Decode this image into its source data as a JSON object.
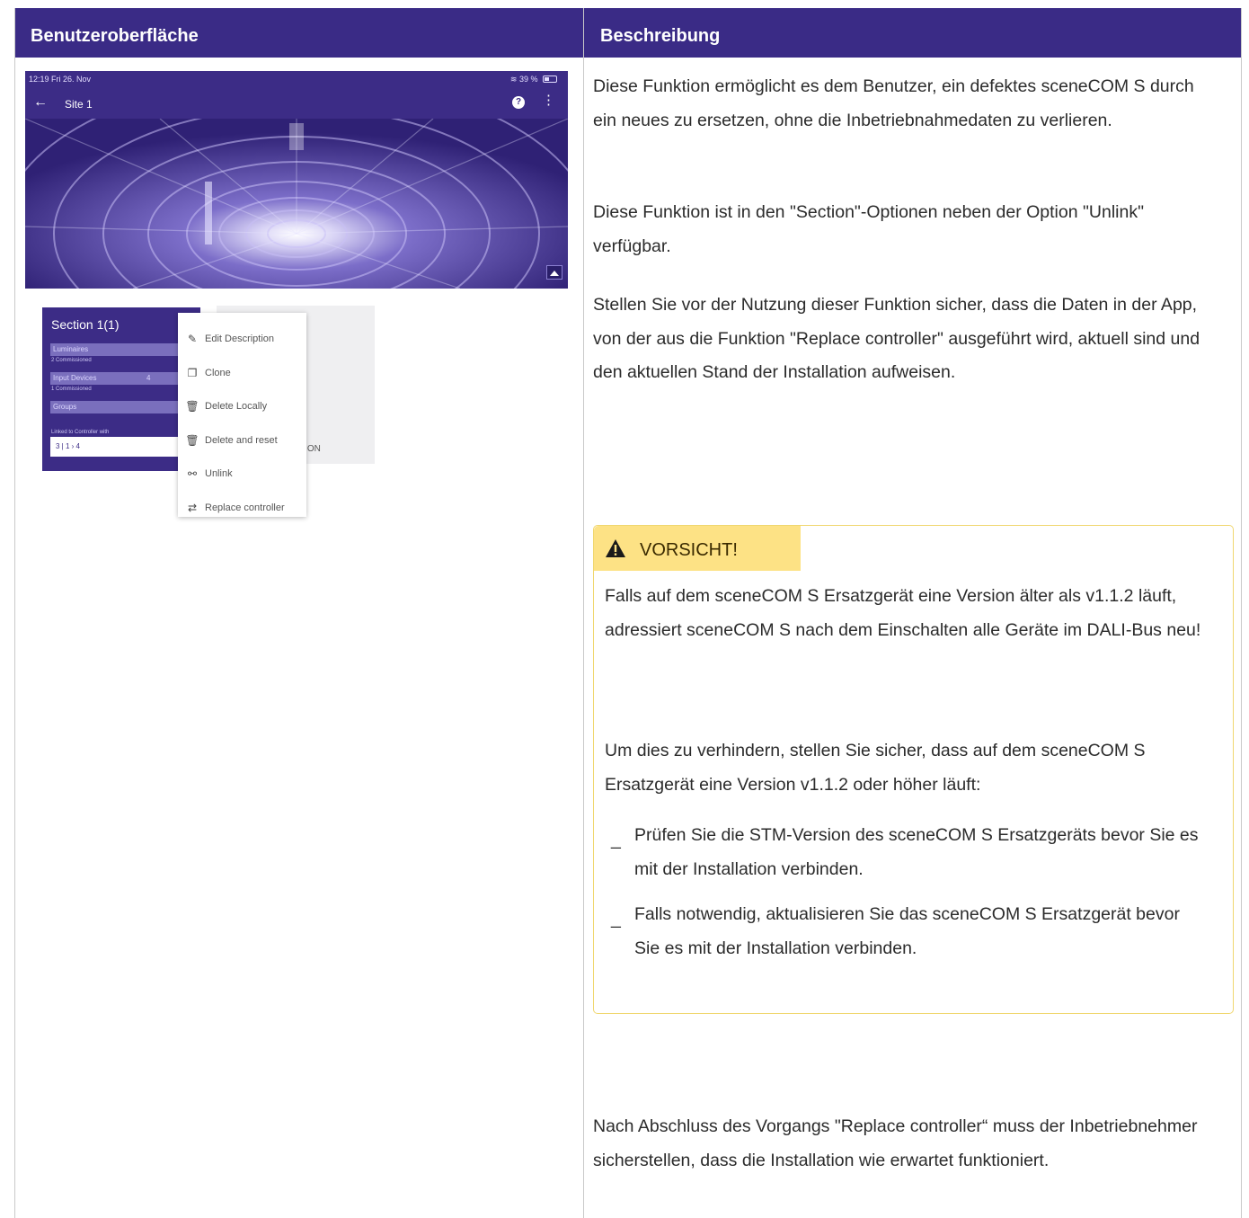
{
  "table": {
    "header_left": "Benutzeroberfläche",
    "header_right": "Beschreibung"
  },
  "screenshot": {
    "status_time": "12:19  Fri 26. Nov",
    "status_battery": "39 %",
    "app_title": "Site 1",
    "back_icon": "←",
    "help_icon": "?",
    "more_icon": "⋮",
    "section": {
      "title": "Section 1(1)",
      "luminaires_label": "Luminaires",
      "luminaires_sub": "2 Commissioned",
      "input_devices_label": "Input Devices",
      "input_devices_count": "4",
      "input_devices_sub": "1 Commissioned",
      "groups_label": "Groups",
      "linked_label": "Linked to Controller with",
      "linked_values": "3  |  1  ›  4"
    },
    "ghost_text": "TION",
    "menu": [
      {
        "label": "Edit Description",
        "icon": "edit-icon"
      },
      {
        "label": "Clone",
        "icon": "copy-icon"
      },
      {
        "label": "Delete Locally",
        "icon": "trash-icon"
      },
      {
        "label": "Delete and reset",
        "icon": "trash-reset-icon"
      },
      {
        "label": "Unlink",
        "icon": "unlink-icon"
      },
      {
        "label": "Replace controller",
        "icon": "swap-icon"
      }
    ]
  },
  "description": {
    "p1": "Diese Funktion ermöglicht es dem Benutzer, ein defektes sceneCOM S durch ein neues zu ersetzen, ohne die Inbetriebnahmedaten zu verlieren.",
    "p2": "Diese Funktion ist in den \"Section\"-Optionen neben der Option \"Unlink\" verfügbar.",
    "p3": "Stellen Sie vor der Nutzung dieser Funktion sicher, dass die Daten in der App, von der aus die Funktion \"Replace controller\" ausgeführt wird, aktuell sind und den aktuellen Stand der Installation aufweisen.",
    "caution": {
      "label": "VORSICHT!",
      "p1": "Falls auf dem sceneCOM S Ersatzgerät eine Version älter als v1.1.2 läuft, adressiert sceneCOM S nach dem Einschalten alle Geräte im DALI-Bus neu!",
      "p2": "Um dies zu verhindern, stellen Sie sicher, dass auf dem sceneCOM S Ersatzgerät eine Version v1.1.2 oder höher läuft:",
      "bullet_mark": "_",
      "bullets": [
        "Prüfen Sie die STM-Version des sceneCOM S Ersatzgeräts bevor Sie es mit der Installation verbinden.",
        "Falls notwendig, aktualisieren Sie das sceneCOM S Ersatzgerät bevor Sie es mit der Installation verbinden."
      ]
    },
    "p4": "Nach Abschluss des Vorgangs \"Replace controller“ muss der Inbetriebnehmer sicherstellen, dass die Installation wie erwartet funktioniert."
  },
  "colors": {
    "header_bg": "#3a2b86",
    "app_purple": "#3c2c86",
    "caution_yellow": "#fde285"
  }
}
